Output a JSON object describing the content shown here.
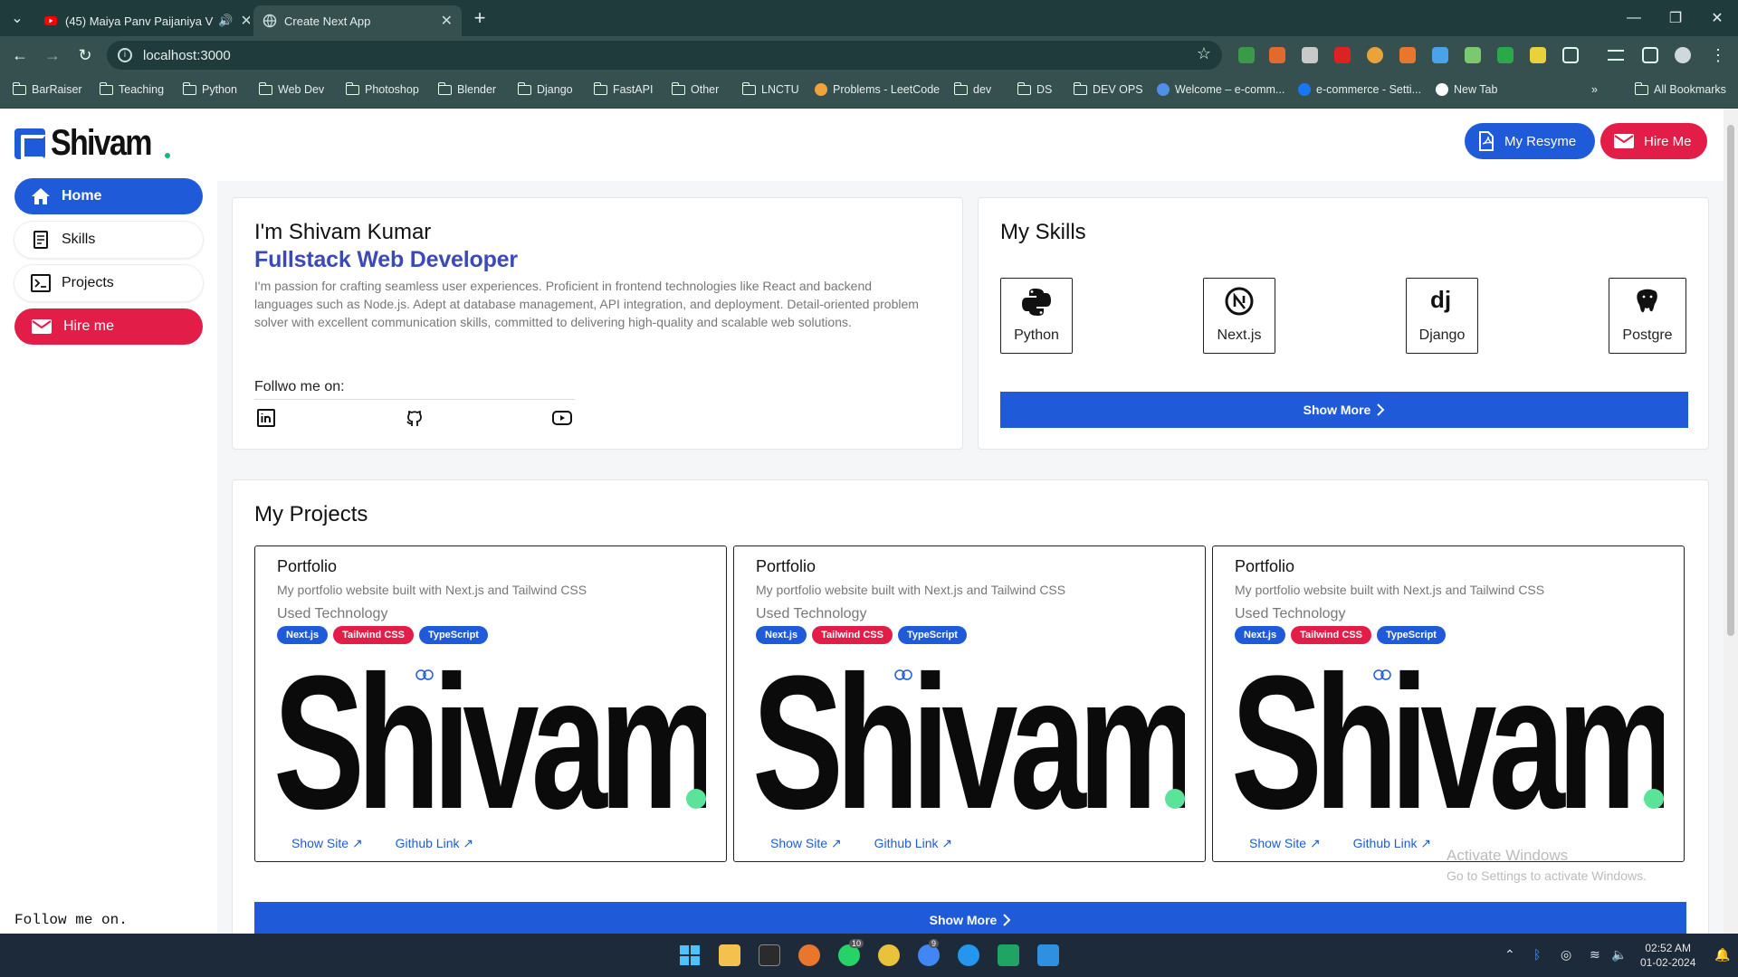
{
  "browser": {
    "tabs": [
      {
        "title": "(45) Maiya Panv Paijaniya V",
        "active": false,
        "audio": true
      },
      {
        "title": "Create Next App",
        "active": true
      }
    ],
    "url": "localhost:3000",
    "bookmarks": [
      "BarRaiser",
      "Teaching",
      "Python",
      "Web Dev",
      "Photoshop",
      "Blender",
      "Django",
      "FastAPI",
      "Other",
      "LNCTU",
      "Problems - LeetCode",
      "dev",
      "DS",
      "DEV OPS",
      "Welcome – e-comm...",
      "e-commerce - Setti...",
      "New Tab"
    ],
    "all_bookmarks": "All Bookmarks"
  },
  "site": {
    "logo": "Shivam",
    "resume_label": "My Resyme",
    "hire_label": "Hire Me",
    "sidebar": {
      "items": [
        {
          "label": "Home",
          "active": true
        },
        {
          "label": "Skills"
        },
        {
          "label": "Projects"
        },
        {
          "label": "Hire me"
        }
      ],
      "follow": "Follow me on."
    },
    "intro": {
      "greeting": "I'm Shivam Kumar",
      "role": "Fullstack Web Developer",
      "bio": "I'm passion for crafting seamless user experiences. Proficient in frontend technologies like React and backend languages such as Node.js. Adept at database management, API integration, and deployment. Detail-oriented problem solver with excellent communication skills, committed to delivering high-quality and scalable web solutions.",
      "follow": "Follwo me on:"
    },
    "skills": {
      "title": "My Skills",
      "items": [
        "Python",
        "Next.js",
        "Django",
        "Postgre"
      ],
      "more": "Show More"
    },
    "projects": {
      "title": "My Projects",
      "items": [
        {
          "name": "Portfolio",
          "desc": "My portfolio website built with Next.js and Tailwind CSS",
          "used": "Used Technology",
          "tags": [
            "Next.js",
            "Tailwind CSS",
            "TypeScript"
          ],
          "image_text": "Shivam",
          "show_site": "Show Site",
          "github": "Github Link"
        },
        {
          "name": "Portfolio",
          "desc": "My portfolio website built with Next.js and Tailwind CSS",
          "used": "Used Technology",
          "tags": [
            "Next.js",
            "Tailwind CSS",
            "TypeScript"
          ],
          "image_text": "Shivam",
          "show_site": "Show Site",
          "github": "Github Link"
        },
        {
          "name": "Portfolio",
          "desc": "My portfolio website built with Next.js and Tailwind CSS",
          "used": "Used Technology",
          "tags": [
            "Next.js",
            "Tailwind CSS",
            "TypeScript"
          ],
          "image_text": "Shivam",
          "show_site": "Show Site",
          "github": "Github Link"
        }
      ],
      "more": "Show More"
    }
  },
  "watermark": {
    "title": "Activate Windows",
    "sub": "Go to Settings to activate Windows."
  },
  "taskbar": {
    "time": "02:52 AM",
    "date": "01-02-2024",
    "badges": [
      "10",
      "9"
    ]
  },
  "colors": {
    "primary": "#1f5bd8",
    "danger": "#e11d48",
    "role": "#3b4ab8"
  }
}
